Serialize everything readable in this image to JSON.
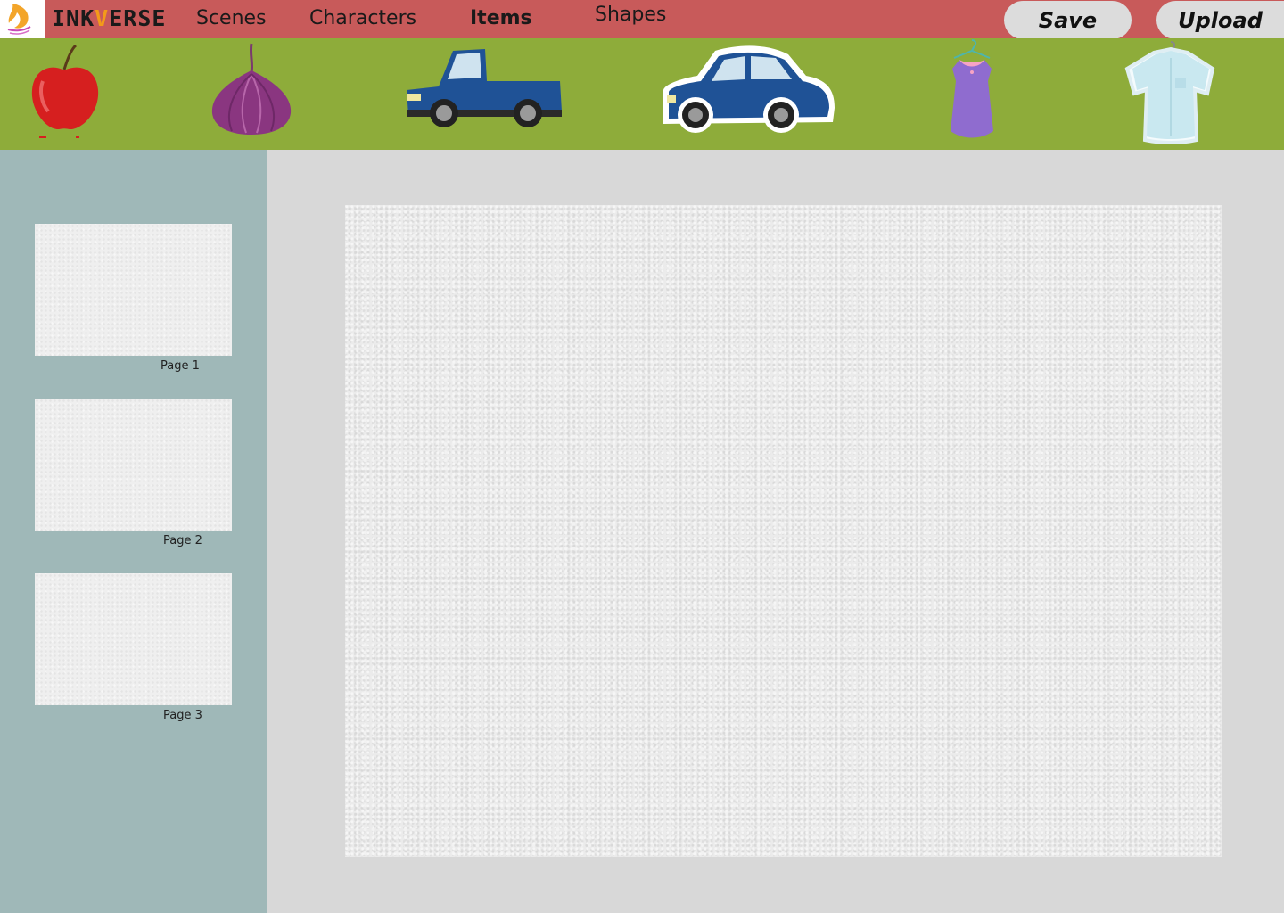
{
  "header": {
    "brand_prefix": "INK",
    "brand_v": "V",
    "brand_suffix": "ERSE",
    "nav": [
      {
        "label": "Scenes"
      },
      {
        "label": "Characters"
      },
      {
        "label": "Items",
        "active": true
      },
      {
        "label": "Shapes"
      }
    ],
    "save_label": "Save",
    "upload_label": "Upload"
  },
  "tray": {
    "items": [
      "apple-icon",
      "onion-icon",
      "pickup-truck-icon",
      "blue-car-icon",
      "purple-dress-icon",
      "blue-shirt-icon"
    ]
  },
  "sidebar": {
    "pages": [
      {
        "label": "Page 1"
      },
      {
        "label": "Page 2"
      },
      {
        "label": "Page 3"
      }
    ]
  },
  "colors": {
    "topbar": "#c85a5a",
    "tray": "#8eac3a",
    "sidebar": "#9fb8b8",
    "workspace": "#d8d8d8",
    "accent": "#f39a1a"
  }
}
